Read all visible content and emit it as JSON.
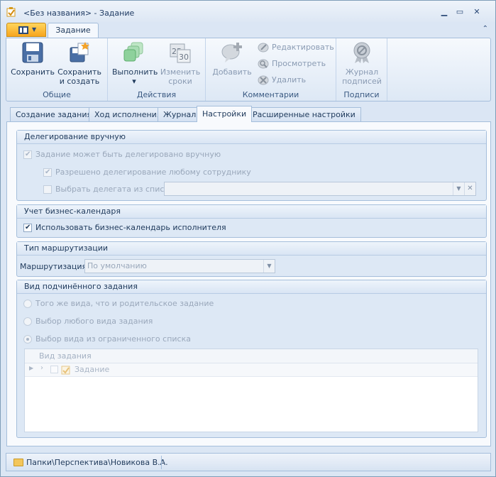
{
  "window": {
    "title": "<Без названия> - Задание",
    "minimize": "▁",
    "maximize": "▭",
    "close": "✕"
  },
  "ribbon": {
    "active_tab": "Задание",
    "collapse": "⌃",
    "groups": {
      "general": {
        "label": "Общие",
        "save": "Сохранить",
        "save_create_1": "Сохранить",
        "save_create_2": "и создать"
      },
      "actions": {
        "label": "Действия",
        "execute": "Выполнить",
        "execute_arrow": "▾",
        "change_1": "Изменить",
        "change_2": "сроки"
      },
      "comments": {
        "label": "Комментарии",
        "add": "Добавить",
        "edit": "Редактировать",
        "view": "Просмотреть",
        "delete": "Удалить"
      },
      "signatures": {
        "label": "Подписи",
        "journal_1": "Журнал",
        "journal_2": "подписей"
      }
    }
  },
  "tabs": [
    "Создание задания",
    "Ход исполнения",
    "Журнал",
    "Настройки",
    "Расширенные настройки"
  ],
  "active_tab_index": 3,
  "delegation": {
    "title": "Делегирование вручную",
    "can_delegate": "Задание может быть делегировано вручную",
    "any_employee": "Разрешено делегирование любому сотруднику",
    "choose_from_list": "Выбрать делегата из списка"
  },
  "calendar": {
    "title": "Учет бизнес-календаря",
    "use_calendar": "Использовать бизнес-календарь исполнителя"
  },
  "routing": {
    "title": "Тип маршрутизации",
    "label": "Маршрутизация:",
    "value": "По умолчанию"
  },
  "subtask": {
    "title": "Вид подчинённого задания",
    "same_kind": "Того же вида, что и родительское задание",
    "any_kind": "Выбор любого вида задания",
    "limited_list": "Выбор вида из ограниченного списка",
    "grid_header": "Вид задания",
    "grid_row": "Задание"
  },
  "status": {
    "path": "Папки\\Перспектива\\Новикова В.А."
  }
}
